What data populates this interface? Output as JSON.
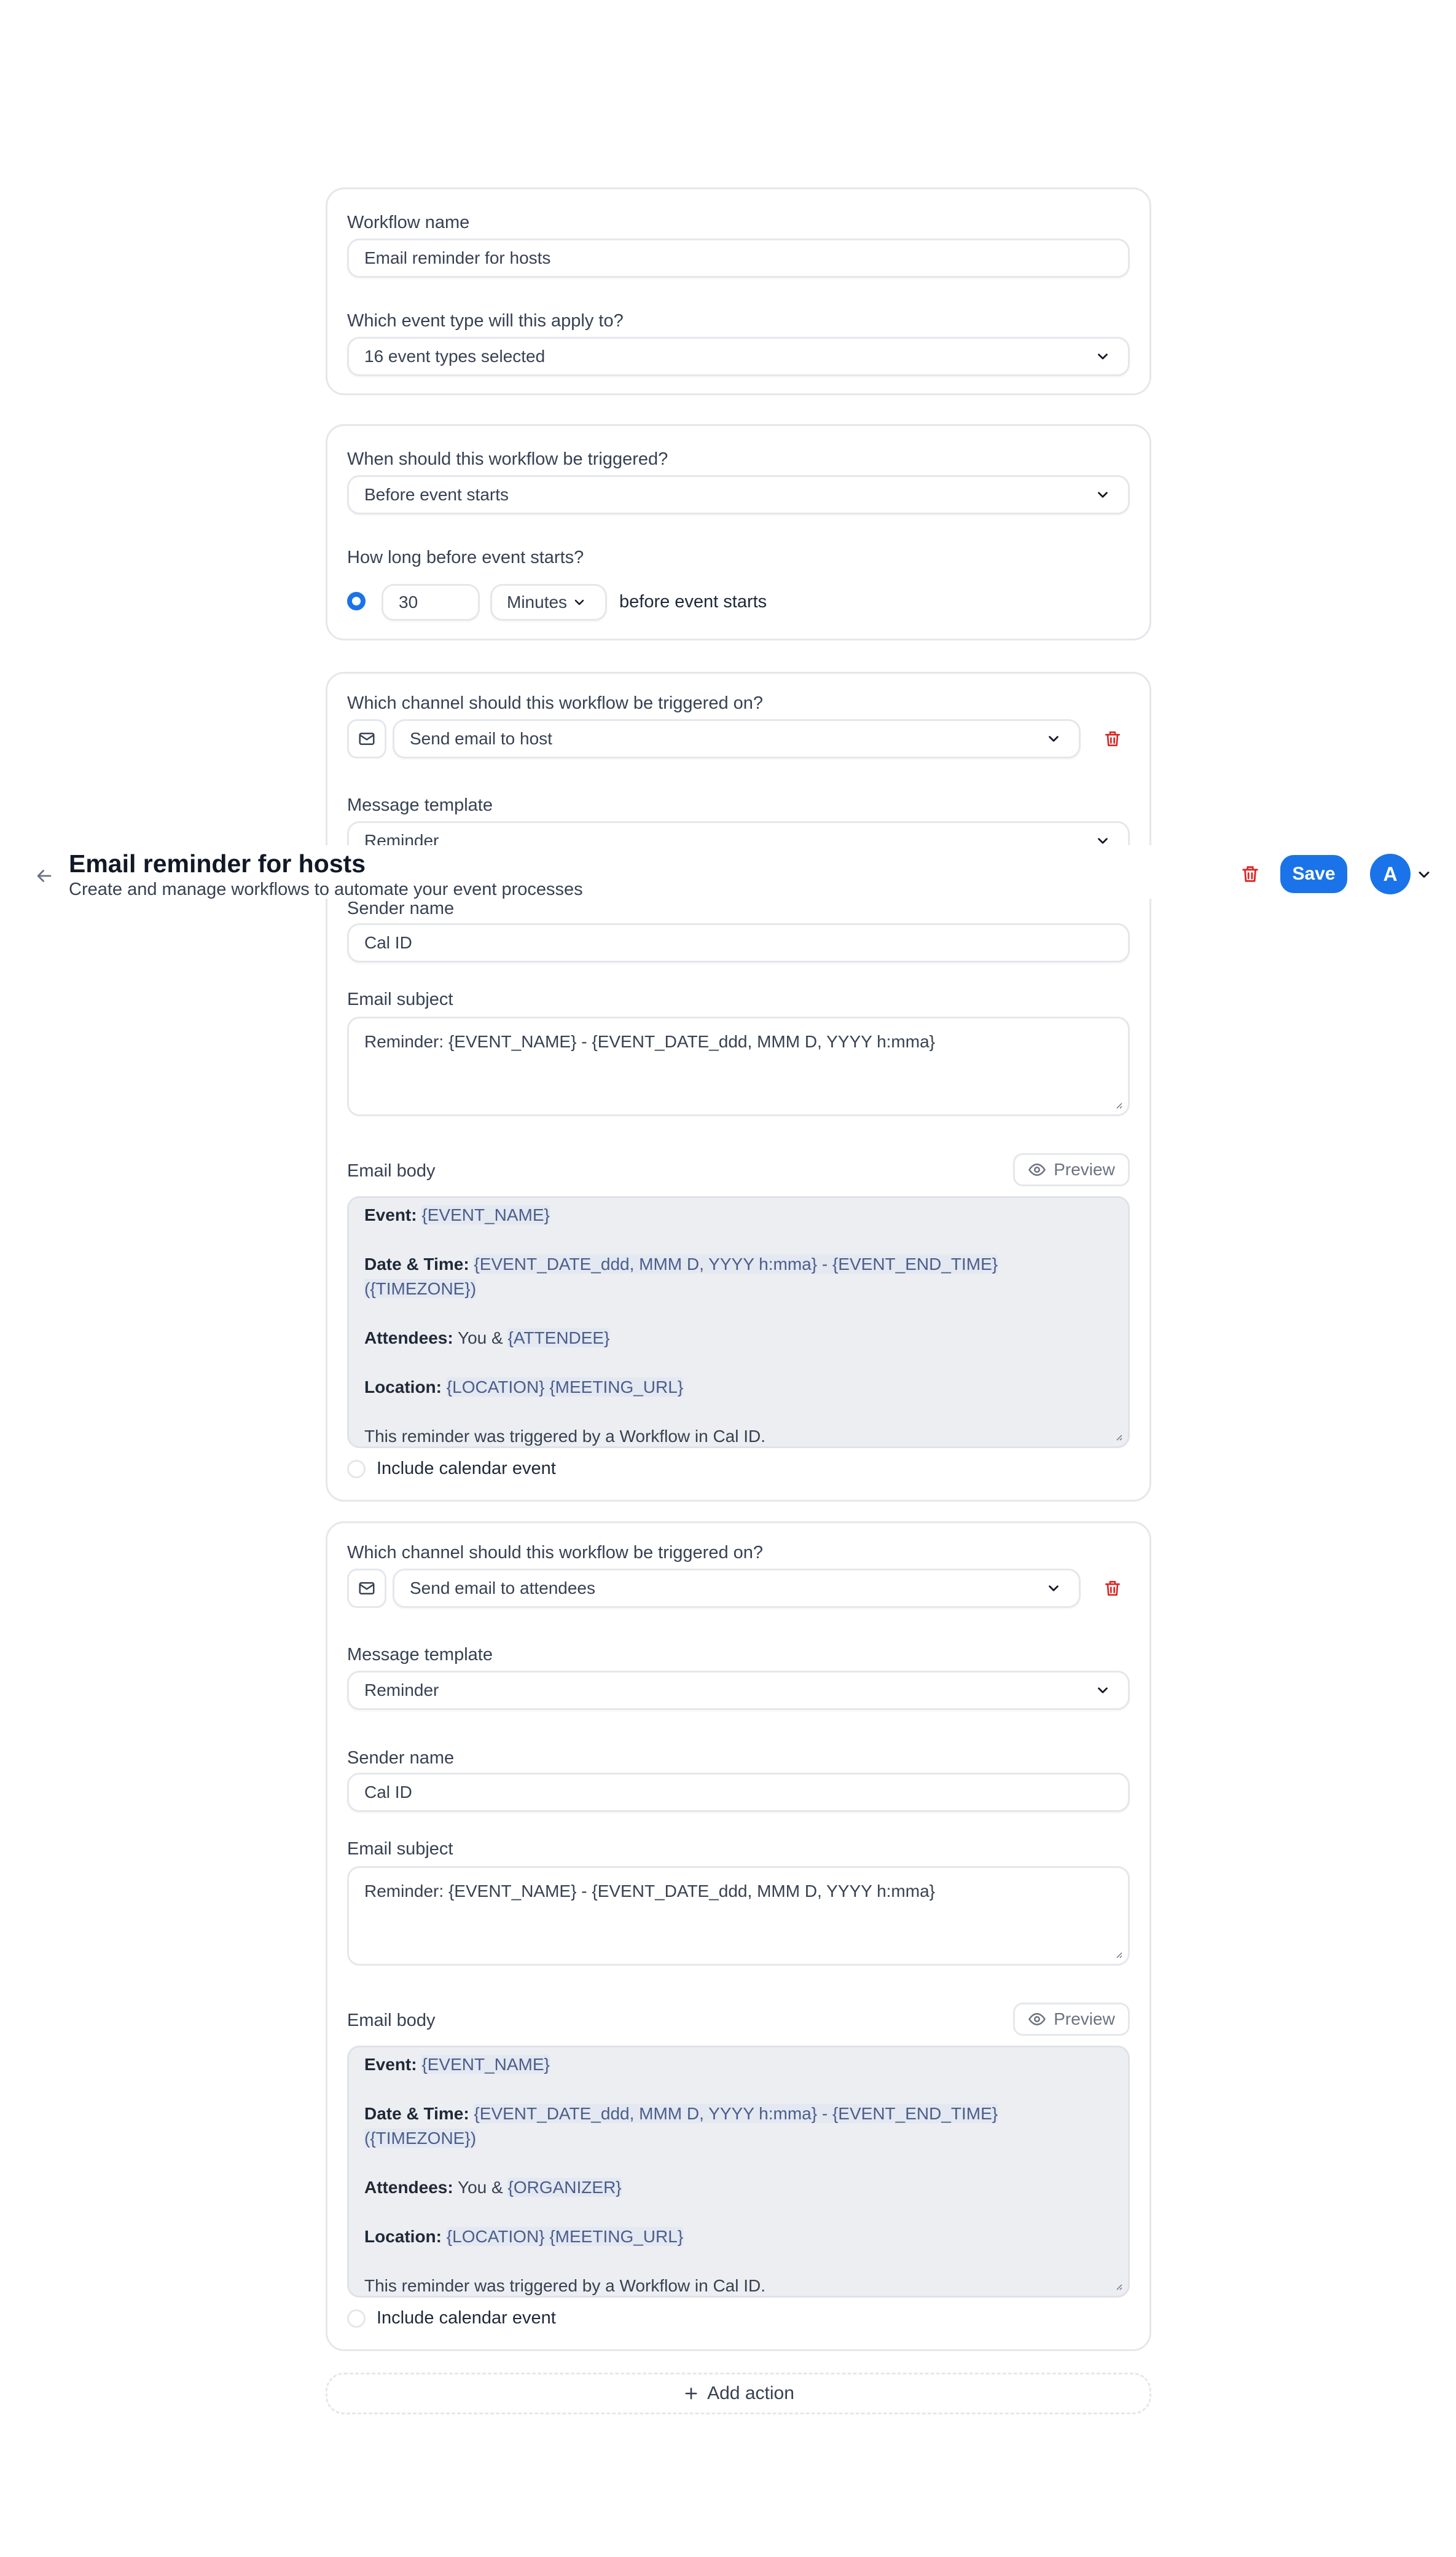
{
  "header": {
    "title": "Email reminder for hosts",
    "subtitle": "Create and manage workflows to automate your event processes",
    "save_label": "Save",
    "avatar_initial": "A"
  },
  "general": {
    "name_label": "Workflow name",
    "name_value": "Email reminder for hosts",
    "event_type_label": "Which event type will this apply to?",
    "event_type_value": "16 event types selected"
  },
  "trigger": {
    "when_label": "When should this workflow be triggered?",
    "when_value": "Before event starts",
    "howlong_label": "How long before event starts?",
    "time_value": "30",
    "unit_value": "Minutes",
    "suffix": "before event starts"
  },
  "actions": [
    {
      "channel_label": "Which channel should this workflow be triggered on?",
      "channel_value": "Send email to host",
      "template_label": "Message template",
      "template_value": "Reminder",
      "sender_label": "Sender name",
      "sender_value": "Cal ID",
      "subject_label": "Email subject",
      "subject_value": "Reminder: {EVENT_NAME} - {EVENT_DATE_ddd, MMM D, YYYY h:mma}",
      "body_label": "Email body",
      "preview_label": "Preview",
      "body": {
        "event_label": "Event:",
        "event_var": "{EVENT_NAME}",
        "datetime_label": "Date & Time:",
        "datetime_var": "{EVENT_DATE_ddd, MMM D, YYYY h:mma} - {EVENT_END_TIME} ({TIMEZONE})",
        "attendees_label": "Attendees:",
        "attendees_prefix": "You &",
        "attendees_var": "{ATTENDEE}",
        "location_label": "Location:",
        "location_var": "{LOCATION} {MEETING_URL}",
        "footer": "This reminder was triggered by a Workflow in Cal ID."
      },
      "include_calendar_label": "Include calendar event"
    },
    {
      "channel_label": "Which channel should this workflow be triggered on?",
      "channel_value": "Send email to attendees",
      "template_label": "Message template",
      "template_value": "Reminder",
      "sender_label": "Sender name",
      "sender_value": "Cal ID",
      "subject_label": "Email subject",
      "subject_value": "Reminder: {EVENT_NAME} - {EVENT_DATE_ddd, MMM D, YYYY h:mma}",
      "body_label": "Email body",
      "preview_label": "Preview",
      "body": {
        "event_label": "Event:",
        "event_var": "{EVENT_NAME}",
        "datetime_label": "Date & Time:",
        "datetime_var": "{EVENT_DATE_ddd, MMM D, YYYY h:mma} - {EVENT_END_TIME} ({TIMEZONE})",
        "attendees_label": "Attendees:",
        "attendees_prefix": "You &",
        "attendees_var": "{ORGANIZER}",
        "location_label": "Location:",
        "location_var": "{LOCATION} {MEETING_URL}",
        "footer": "This reminder was triggered by a Workflow in Cal ID."
      },
      "include_calendar_label": "Include calendar event"
    }
  ],
  "add_action_label": "Add action",
  "colors": {
    "accent": "#1a73e8",
    "danger": "#dc2626",
    "border": "#e5e7eb"
  }
}
